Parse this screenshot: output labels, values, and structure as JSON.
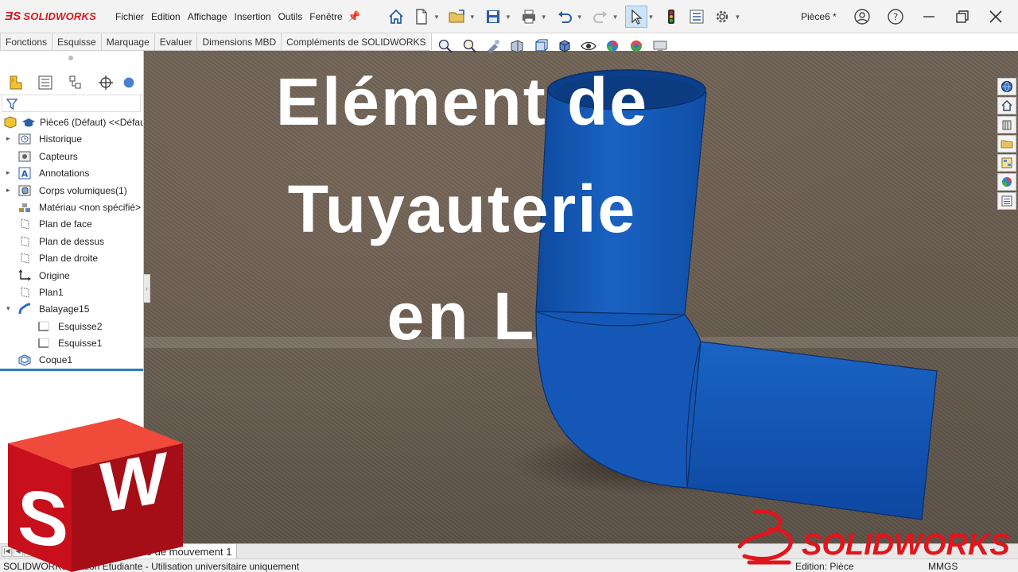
{
  "app": {
    "brand": "SOLIDWORKS",
    "document_name": "Pièce6 *"
  },
  "menu": [
    "Fichier",
    "Edition",
    "Affichage",
    "Insertion",
    "Outils",
    "Fenêtre"
  ],
  "command_tabs": [
    "Fonctions",
    "Esquisse",
    "Marquage",
    "Evaluer",
    "Dimensions MBD",
    "Compléments de SOLIDWORKS"
  ],
  "feature_tree": [
    {
      "label": "Pièce6 (Défaut) <<Défaut>",
      "icon": "part-icon",
      "expandable": false,
      "indent": 0
    },
    {
      "label": "Historique",
      "icon": "history-icon",
      "expandable": true,
      "indent": 1
    },
    {
      "label": "Capteurs",
      "icon": "sensor-icon",
      "expandable": false,
      "indent": 1
    },
    {
      "label": "Annotations",
      "icon": "annotations-icon",
      "expandable": true,
      "indent": 1
    },
    {
      "label": "Corps volumiques(1)",
      "icon": "solid-bodies-icon",
      "expandable": true,
      "indent": 1
    },
    {
      "label": "Matériau <non spécifié>",
      "icon": "material-icon",
      "expandable": false,
      "indent": 1
    },
    {
      "label": "Plan de face",
      "icon": "plane-icon",
      "expandable": false,
      "indent": 1
    },
    {
      "label": "Plan de dessus",
      "icon": "plane-icon",
      "expandable": false,
      "indent": 1
    },
    {
      "label": "Plan de droite",
      "icon": "plane-icon",
      "expandable": false,
      "indent": 1
    },
    {
      "label": "Origine",
      "icon": "origin-icon",
      "expandable": false,
      "indent": 1
    },
    {
      "label": "Plan1",
      "icon": "plane-icon",
      "expandable": false,
      "indent": 1
    },
    {
      "label": "Balayage15",
      "icon": "sweep-icon",
      "expandable": true,
      "expanded": true,
      "indent": 1
    },
    {
      "label": "Esquisse2",
      "icon": "sketch-icon",
      "expandable": false,
      "indent": 2
    },
    {
      "label": "Esquisse1",
      "icon": "sketch-icon",
      "expandable": false,
      "indent": 2
    },
    {
      "label": "Coque1",
      "icon": "shell-icon",
      "expandable": false,
      "indent": 1
    }
  ],
  "overlay_title": {
    "line1": "Elément de",
    "line2": "Tuyauterie",
    "line3": "en L"
  },
  "model_tab": "Etude de mouvement 1",
  "status": {
    "left": "SOLIDWORKS Edition Etudiante - Utilisation universitaire uniquement",
    "edit": "Edition: Pièce",
    "units": "MMGS"
  },
  "colors": {
    "accent_red": "#d71920",
    "pipe_blue": "#1558b8",
    "selection_blue": "#cfe3f7"
  }
}
